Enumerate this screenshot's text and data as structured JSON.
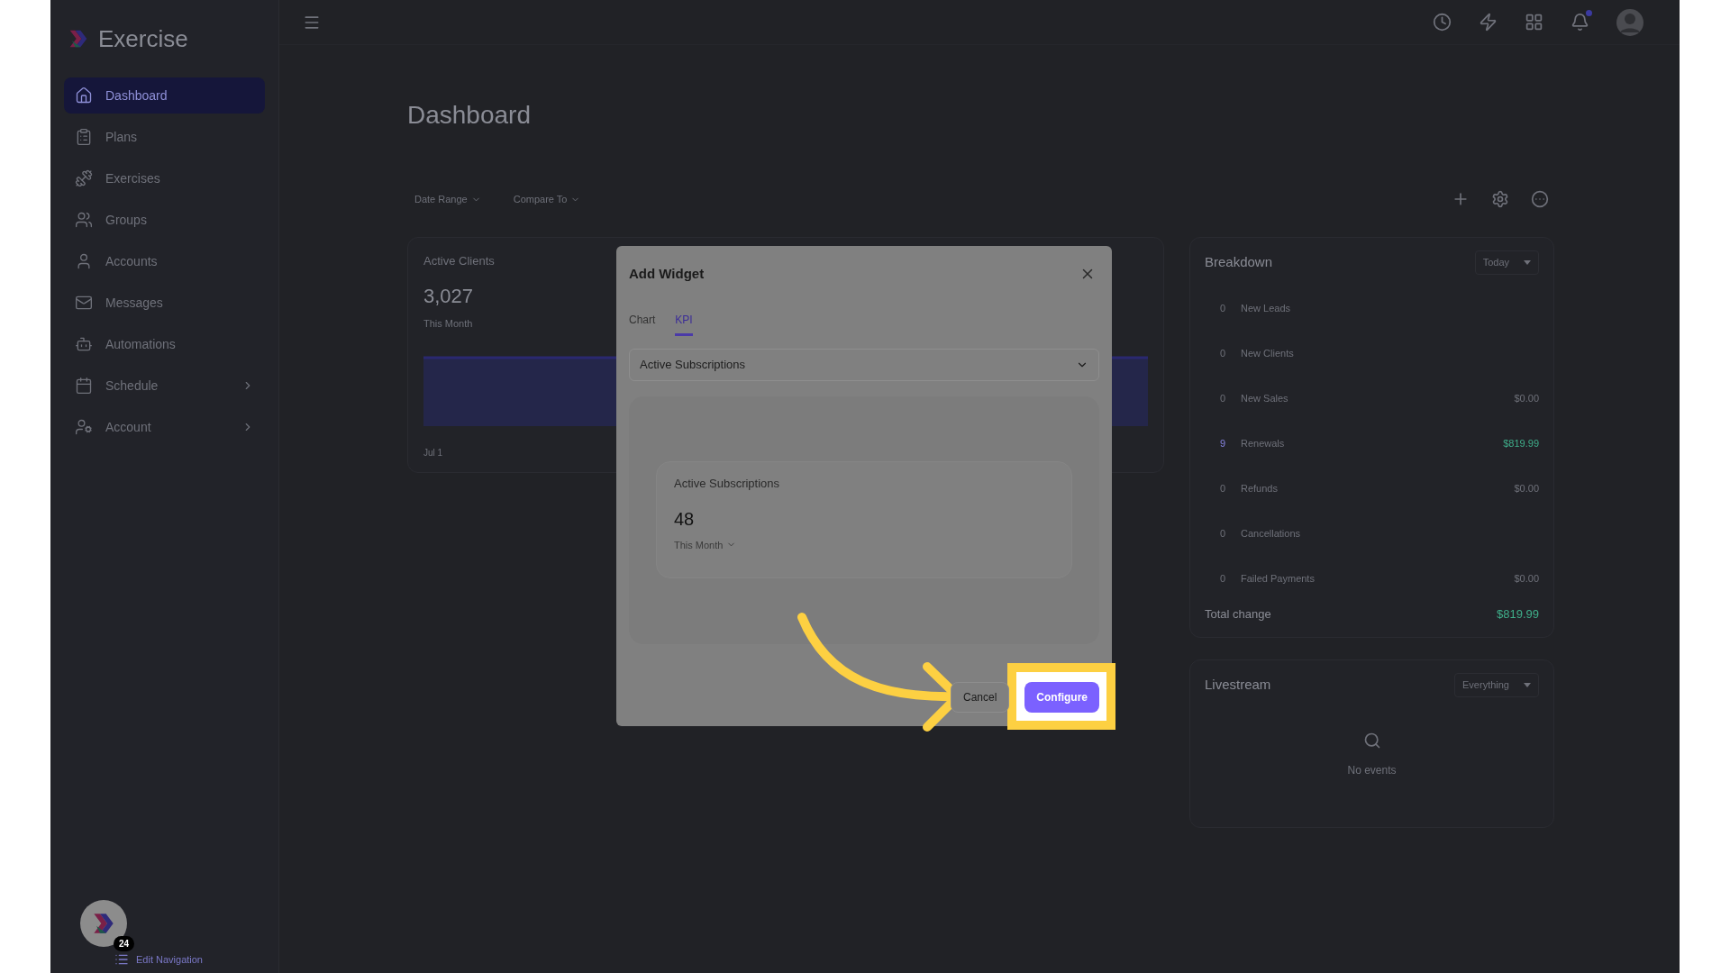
{
  "app": {
    "name": "Exercise"
  },
  "sidebar": {
    "items": [
      {
        "label": "Dashboard",
        "selected": true,
        "has_submenu": false
      },
      {
        "label": "Plans",
        "selected": false,
        "has_submenu": false
      },
      {
        "label": "Exercises",
        "selected": false,
        "has_submenu": false
      },
      {
        "label": "Groups",
        "selected": false,
        "has_submenu": false
      },
      {
        "label": "Accounts",
        "selected": false,
        "has_submenu": false
      },
      {
        "label": "Messages",
        "selected": false,
        "has_submenu": false
      },
      {
        "label": "Automations",
        "selected": false,
        "has_submenu": false
      },
      {
        "label": "Schedule",
        "selected": false,
        "has_submenu": true
      },
      {
        "label": "Account",
        "selected": false,
        "has_submenu": true
      }
    ],
    "footer": {
      "badge": "24",
      "link": "Edit Navigation"
    }
  },
  "header": {
    "notifications_unread": true
  },
  "page": {
    "title": "Dashboard",
    "filters": [
      "Date Range",
      "Compare To"
    ]
  },
  "active_clients": {
    "title": "Active Clients",
    "value": "3,027",
    "period": "This Month",
    "x_label": "Jul 1"
  },
  "breakdown": {
    "title": "Breakdown",
    "period": "Today",
    "rows": [
      {
        "count": "0",
        "label": "New Leads",
        "positive": false
      },
      {
        "count": "0",
        "label": "New Clients",
        "positive": false
      },
      {
        "count": "0",
        "label": "New Sales",
        "amount": "$0.00",
        "positive": false
      },
      {
        "count": "9",
        "label": "Renewals",
        "amount": "$819.99",
        "positive": true
      },
      {
        "count": "0",
        "label": "Refunds",
        "amount": "$0.00",
        "positive": false
      },
      {
        "count": "0",
        "label": "Cancellations",
        "positive": false
      },
      {
        "count": "0",
        "label": "Failed Payments",
        "amount": "$0.00",
        "positive": false
      }
    ],
    "total_label": "Total change",
    "total": "$819.99"
  },
  "livestream": {
    "title": "Livestream",
    "filter": "Everything",
    "empty_text": "No events"
  },
  "dialog": {
    "title": "Add Widget",
    "tabs": [
      {
        "label": "Chart",
        "selected": false
      },
      {
        "label": "KPI",
        "selected": true
      }
    ],
    "metric": "Active Subscriptions",
    "preview": {
      "title": "Active Subscriptions",
      "value": "48",
      "period": "This Month"
    },
    "buttons": [
      {
        "label": "Cancel",
        "kind": "secondary",
        "highlighted": false
      },
      {
        "label": "Configure",
        "kind": "primary",
        "highlighted": true
      }
    ]
  }
}
